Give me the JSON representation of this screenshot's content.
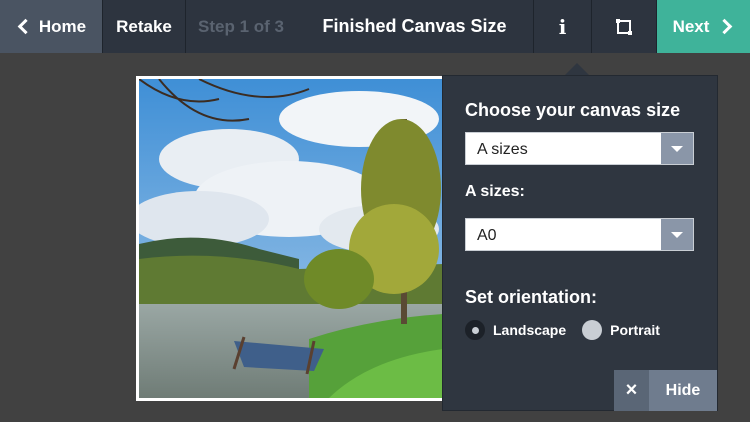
{
  "toolbar": {
    "home_label": "Home",
    "retake_label": "Retake",
    "step_label": "Step 1 of 3",
    "title": "Finished Canvas Size",
    "next_label": "Next",
    "info_icon": "info-icon",
    "crop_icon": "crop-icon"
  },
  "panel": {
    "canvas_heading": "Choose your canvas size",
    "size_type_value": "A sizes",
    "sizes_heading": "A sizes:",
    "size_value": "A0",
    "orientation_heading": "Set orientation:",
    "orientation_options": [
      "Landscape",
      "Portrait"
    ],
    "orientation_selected": "Landscape",
    "hide_label": "Hide",
    "hide_icon": "×"
  },
  "colors": {
    "next_accent": "#3fb39a",
    "toolbar_bg": "#2d343f",
    "panel_bg": "#2f3640"
  }
}
